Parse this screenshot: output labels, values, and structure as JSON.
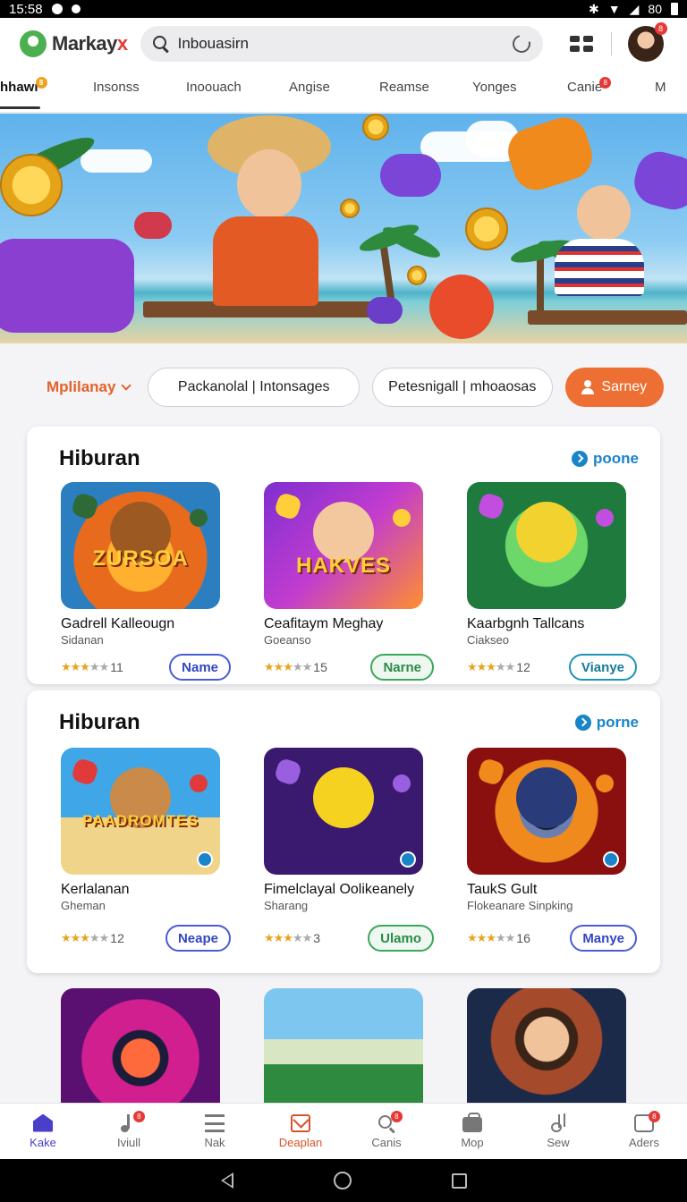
{
  "status_bar": {
    "time": "15:58",
    "signal_text": "80"
  },
  "header": {
    "logo_text_main": "Markay",
    "logo_text_accent": "x",
    "search_value": "Inbouasirn",
    "avatar_badge": "8"
  },
  "tabs": [
    {
      "label": "hhawı",
      "badge": "8",
      "badge_color": "#f0a21d"
    },
    {
      "label": "Insonss"
    },
    {
      "label": "Inoouach"
    },
    {
      "label": "Angise"
    },
    {
      "label": "Reamse"
    },
    {
      "label": "Yonges"
    },
    {
      "label": "Canie",
      "badge": "8",
      "badge_color": "#e53935"
    },
    {
      "label": "M"
    }
  ],
  "filters": {
    "sort_label": "Mplilanay",
    "pill_1": "Packanolal | Intonsages",
    "pill_2": "Petesnigall | mhoaosas",
    "cta_label": "Sarney"
  },
  "sections": [
    {
      "title": "Hiburan",
      "more_label": "poone",
      "apps": [
        {
          "name": "Gadrell Kalleougn",
          "sub": "Sidanan",
          "rating": "11",
          "stars": 3,
          "button": "Name",
          "btn_style": "blue",
          "thumb_text": "ZURSOA",
          "icon": "bear-mascot-icon"
        },
        {
          "name": "Ceafitaym Meghay",
          "sub": "Goeanso",
          "rating": "15",
          "stars": 3,
          "button": "Narne",
          "btn_style": "green",
          "thumb_text": "HAKVES",
          "icon": "girl-game-icon"
        },
        {
          "name": "Kaarbgnh Tallcans",
          "sub": "Ciakseo",
          "rating": "12",
          "stars": 3,
          "button": "Vianye",
          "btn_style": "teal",
          "thumb_text": "",
          "icon": "cat-mascot-icon"
        }
      ]
    },
    {
      "title": "Hiburan",
      "more_label": "porne",
      "apps": [
        {
          "name": "Kerlalanan",
          "sub": "Gheman",
          "rating": "12",
          "stars": 3,
          "button": "Neape",
          "btn_style": "blue",
          "thumb_text": "PAADROMTES",
          "icon": "bear-beach-icon"
        },
        {
          "name": "Fimelclayal Oolikeanely",
          "sub": "Sharang",
          "rating": "3",
          "stars": 3,
          "button": "Ulamo",
          "btn_style": "green",
          "thumb_text": "",
          "icon": "happy-cat-icon"
        },
        {
          "name": "TaukS Gult",
          "sub": "Flokeanare Sinpking",
          "rating": "16",
          "stars": 3,
          "button": "Manye",
          "btn_style": "blue",
          "thumb_text": "",
          "icon": "lens-duck-icon"
        }
      ]
    }
  ],
  "bottom_nav": [
    {
      "label": "Kake",
      "icon": "home-icon",
      "active": true
    },
    {
      "label": "Iviull",
      "icon": "music-icon",
      "badge": "8"
    },
    {
      "label": "Nak",
      "icon": "list-icon"
    },
    {
      "label": "Deaplan",
      "icon": "mail-icon",
      "highlight": true
    },
    {
      "label": "Canis",
      "icon": "search-icon",
      "badge": "8"
    },
    {
      "label": "Mop",
      "icon": "bag-icon"
    },
    {
      "label": "Sew",
      "icon": "music-note-icon"
    },
    {
      "label": "Aders",
      "icon": "ads-icon",
      "badge": "8"
    }
  ],
  "colors": {
    "accent_orange": "#ee6f33",
    "link_blue": "#1a84c9",
    "nav_active": "#4a3fc9"
  }
}
